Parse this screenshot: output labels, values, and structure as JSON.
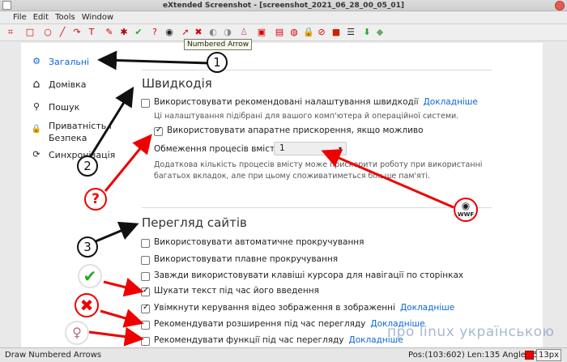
{
  "window": {
    "title": "eXtended Screenshot - [screenshot_2021_06_28_00_05_01]"
  },
  "menu": [
    "File",
    "Edit",
    "Tools",
    "Window"
  ],
  "toolbar": {
    "tools": [
      {
        "name": "crop-tool-icon",
        "glyph": "⌗",
        "color": "#d00"
      },
      {
        "name": "rectangle-tool-icon",
        "glyph": "□",
        "color": "#d00"
      },
      {
        "name": "ellipse-tool-icon",
        "glyph": "○",
        "color": "#d00"
      },
      {
        "name": "line-tool-icon",
        "glyph": "╱",
        "color": "#d00"
      },
      {
        "name": "curve-tool-icon",
        "glyph": "↷",
        "color": "#d00"
      },
      {
        "name": "text-tool-icon",
        "glyph": "T",
        "color": "#d00"
      },
      {
        "name": "pen-tool-icon",
        "glyph": "✎",
        "color": "#d00"
      },
      {
        "name": "bug-sticker-icon",
        "glyph": "✱",
        "color": "#b00"
      },
      {
        "name": "check-sticker-icon",
        "glyph": "✔",
        "color": "#2a2"
      },
      {
        "name": "question-sticker-icon",
        "glyph": "?",
        "color": "#d00"
      },
      {
        "name": "panda-sticker-icon",
        "glyph": "◉",
        "color": "#222"
      },
      {
        "name": "numbered-arrow-icon",
        "glyph": "➚",
        "color": "#d00"
      },
      {
        "name": "cross-sticker-icon",
        "glyph": "✖",
        "color": "#d00"
      },
      {
        "name": "mouse-icon",
        "glyph": "◐",
        "color": "#888"
      },
      {
        "name": "mouse-alt-icon",
        "glyph": "◑",
        "color": "#888"
      },
      {
        "name": "figure-icon",
        "glyph": "♙",
        "color": "#b68"
      },
      {
        "name": "stamp-icon",
        "glyph": "▣",
        "color": "#d00"
      },
      {
        "name": "image-icon",
        "glyph": "▤",
        "color": "#d00"
      },
      {
        "name": "blur-icon",
        "glyph": "◍",
        "color": "#d00"
      },
      {
        "name": "lock-icon",
        "glyph": "🔒",
        "color": "#aa8"
      },
      {
        "name": "no-entry-icon",
        "glyph": "⊘",
        "color": "#d00"
      },
      {
        "name": "color-picker-icon",
        "glyph": "■",
        "color": "#c20"
      },
      {
        "name": "line-width-icon",
        "glyph": "☰",
        "color": "#222"
      },
      {
        "name": "download-icon",
        "glyph": "⬇",
        "color": "#2a2"
      },
      {
        "name": "layers-icon",
        "glyph": "◆",
        "color": "#6a6"
      }
    ],
    "tooltip": "Numbered Arrow"
  },
  "nav": [
    {
      "icon": "gear-icon",
      "glyph": "⚙",
      "label": "Загальні",
      "active": true
    },
    {
      "icon": "home-icon",
      "glyph": "⌂",
      "label": "Домівка",
      "active": false
    },
    {
      "icon": "search-icon",
      "glyph": "⚲",
      "label": "Пошук",
      "active": false
    },
    {
      "icon": "lock-icon",
      "glyph": "🔒",
      "label": "Приватність і\nБезпека",
      "active": false
    },
    {
      "icon": "sync-icon",
      "glyph": "⟳",
      "label": "Синхронізація",
      "active": false
    }
  ],
  "performance": {
    "title": "Швидкодія",
    "recommended": {
      "label": "Використовувати рекомендовані налаштування швидкодії",
      "link": "Докладніше",
      "checked": false,
      "desc": "Ці налаштування підібрані для вашого комп'ютера й операційної системи."
    },
    "hw_accel": {
      "label": "Використовувати апаратне прискорення, якщо можливо",
      "checked": true
    },
    "process_limit": {
      "label": "Обмеження процесів вмісту",
      "value": "1",
      "desc_line1": "Додаткова кількість процесів вмісту може прискорити роботу при використанні",
      "desc_line2": "багатьох вкладок, але при цьому споживатиметься більше пам'яті."
    }
  },
  "browsing": {
    "title": "Перегляд сайтів",
    "options": [
      {
        "label": "Використовувати автоматичне прокручування",
        "checked": false,
        "link": ""
      },
      {
        "label": "Використовувати плавне прокручування",
        "checked": false,
        "link": ""
      },
      {
        "label": "Завжди використовувати клавіші курсора для навігації по сторінках",
        "checked": false,
        "link": ""
      },
      {
        "label": "Шукати текст під час його введення",
        "checked": true,
        "link": ""
      },
      {
        "label": "Увімкнути керування відео зображення в зображенні",
        "checked": true,
        "link": "Докладніше"
      },
      {
        "label": "Рекомендувати розширення під час перегляду",
        "checked": false,
        "link": "Докладніше"
      },
      {
        "label": "Рекомендувати функції під час перегляду",
        "checked": false,
        "link": "Докладніше"
      }
    ]
  },
  "annotations": {
    "n1": "1",
    "n2": "2",
    "n3": "3",
    "question": "?",
    "wwf_line1": "WWF",
    "wwf_line2": "U"
  },
  "watermark": "про linux українською",
  "status": {
    "left": "Draw Numbered Arrows",
    "coords": "Pos:(103:602) Len:135 Angle:352",
    "size": "13px",
    "color": "#e00000"
  }
}
